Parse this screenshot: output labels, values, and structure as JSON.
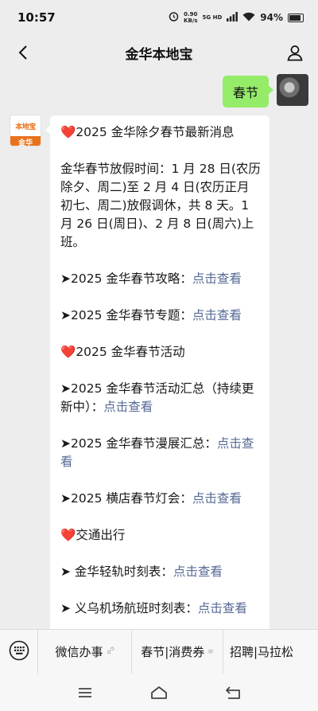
{
  "status_bar": {
    "time": "10:57",
    "net_speed_value": "0.90",
    "net_speed_unit": "KB/s",
    "signal_label": "5G HD",
    "battery": "94%"
  },
  "nav": {
    "title": "金华本地宝",
    "back_icon": "chevron-left-icon",
    "profile_icon": "person-icon"
  },
  "chat": {
    "user_message": "春节",
    "bot_avatar": {
      "top": "本地宝",
      "bottom": "金华"
    },
    "reply": {
      "heading": "2025 金华除夕春节最新消息",
      "holiday_text": "金华春节放假时间：1 月 28 日(农历除夕、周二)至 2 月 4 日(农历正月初七、周二)放假调休，共 8 天。1 月 26 日(周日)、2 月 8 日(周六)上班。",
      "items": [
        {
          "prefix": "➤2025 金华春节攻略：",
          "link": "点击查看"
        },
        {
          "prefix": "➤2025 金华春节专题：",
          "link": "点击查看"
        }
      ],
      "section_activity": "2025 金华春节活动",
      "activity_items": [
        {
          "prefix": "➤2025 金华春节活动汇总（持续更新中）：",
          "link": "点击查看"
        },
        {
          "prefix": "➤2025 金华春节漫展汇总：",
          "link": "点击查看"
        },
        {
          "prefix": "➤2025 横店春节灯会：",
          "link": "点击查看"
        }
      ],
      "section_traffic": "交通出行",
      "traffic_items": [
        {
          "prefix": "➤ 金华轻轨时刻表：",
          "link": "点击查看"
        },
        {
          "prefix": "➤ 义乌机场航班时刻表：",
          "link": "点击查看"
        }
      ]
    }
  },
  "bottom_menu": {
    "keyboard_icon": "keyboard-icon",
    "items": [
      {
        "label": "微信办事",
        "mark": "🔗"
      },
      {
        "label": "春节|消费券",
        "mark": "≡"
      },
      {
        "label": "招聘|马拉松",
        "mark": ""
      }
    ]
  },
  "system_nav": {
    "menu_icon": "menu-icon",
    "home_icon": "home-icon",
    "back_icon": "back-icon"
  }
}
